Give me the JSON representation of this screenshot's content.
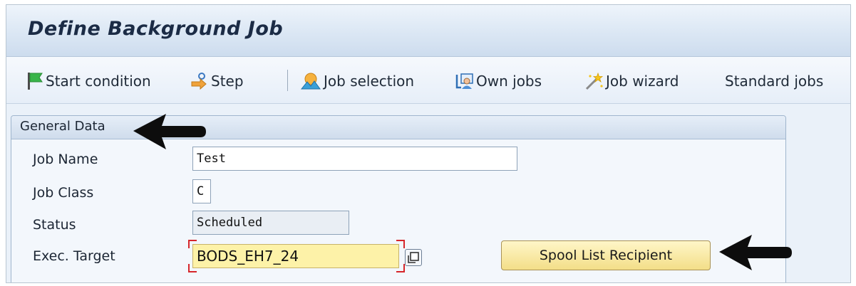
{
  "window": {
    "title": "Define Background Job"
  },
  "toolbar": {
    "items": [
      {
        "label": "Start condition",
        "icon": "green-flag-icon"
      },
      {
        "label": "Step",
        "icon": "step-icon"
      },
      {
        "label": "Job selection",
        "icon": "job-selection-icon"
      },
      {
        "label": "Own jobs",
        "icon": "own-jobs-icon"
      },
      {
        "label": "Job wizard",
        "icon": "magic-wand-icon"
      },
      {
        "label": "Standard jobs",
        "icon": ""
      }
    ]
  },
  "general_data": {
    "title": "General Data",
    "job_name": {
      "label": "Job Name",
      "value": "Test"
    },
    "job_class": {
      "label": "Job Class",
      "value": "C"
    },
    "status": {
      "label": "Status",
      "value": "Scheduled"
    },
    "exec_target": {
      "label": "Exec. Target",
      "value": "BODS_EH7_24"
    },
    "spool_button": "Spool List Recipient"
  },
  "colors": {
    "required_field_bg": "#fdf2a8",
    "button_bg": "#f3de88",
    "header_bg": "#dbe7f4"
  }
}
